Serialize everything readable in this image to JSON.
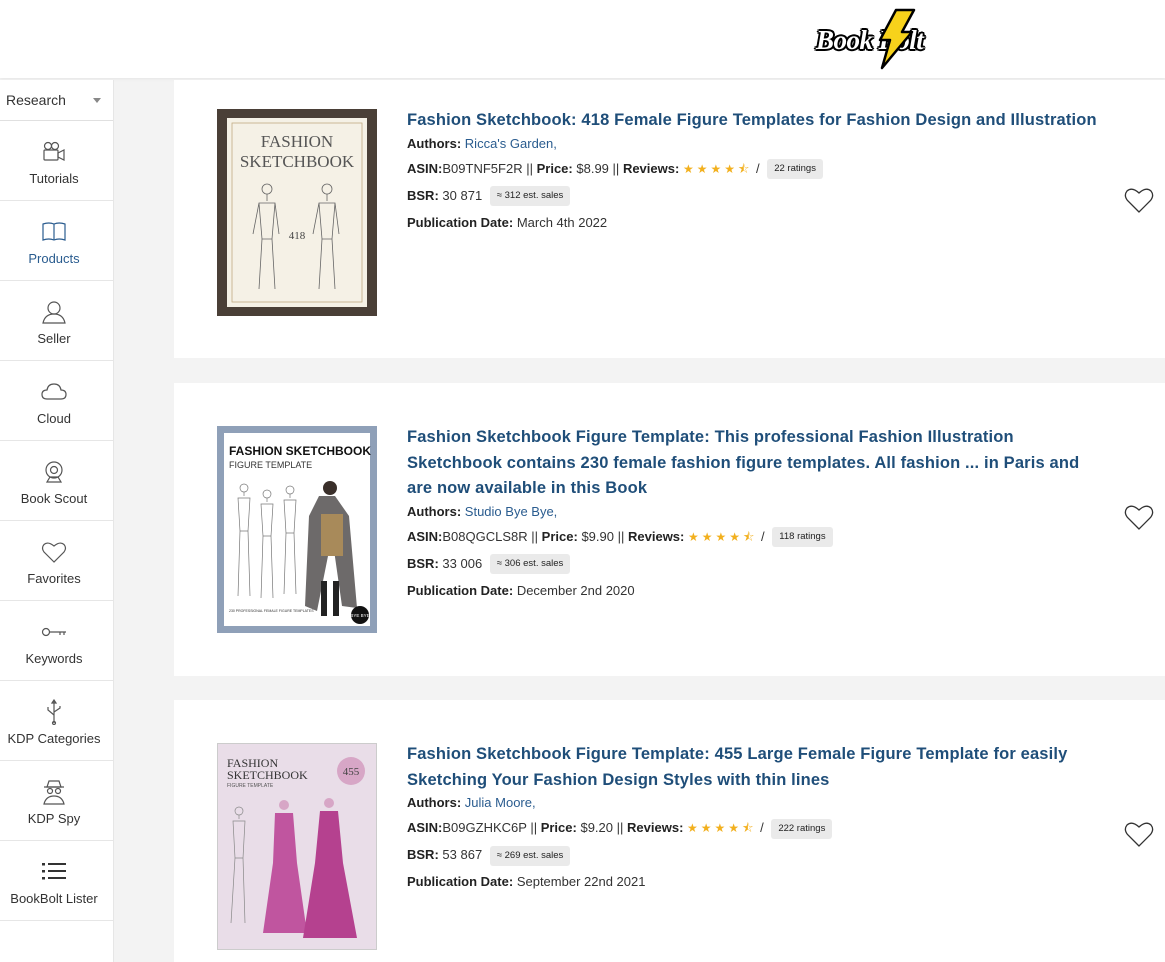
{
  "brand": {
    "logo_text": "Book Bolt"
  },
  "sidebar": {
    "dropdown": {
      "label": "Research"
    },
    "items": [
      {
        "label": "Tutorials",
        "icon": "video-camera-icon"
      },
      {
        "label": "Products",
        "icon": "open-book-icon",
        "active": true
      },
      {
        "label": "Seller",
        "icon": "user-icon"
      },
      {
        "label": "Cloud",
        "icon": "cloud-icon"
      },
      {
        "label": "Book Scout",
        "icon": "webcam-icon"
      },
      {
        "label": "Favorites",
        "icon": "heart-icon"
      },
      {
        "label": "Keywords",
        "icon": "key-icon"
      },
      {
        "label": "KDP Categories",
        "icon": "usb-icon"
      },
      {
        "label": "KDP Spy",
        "icon": "spy-icon"
      },
      {
        "label": "BookBolt Lister",
        "icon": "list-icon"
      }
    ]
  },
  "labels": {
    "authors": "Authors:",
    "asin": "ASIN:",
    "price": "Price:",
    "reviews": "Reviews:",
    "bsr": "BSR:",
    "publication_date": "Publication Date:",
    "sep": "||",
    "slash": "/"
  },
  "products": [
    {
      "title": "Fashion Sketchbook: 418 Female Figure Templates for Fashion Design and Illustration",
      "author": "Ricca's Garden,",
      "asin": "B09TNF5F2R",
      "price": "$8.99",
      "stars": "★★★★⯪",
      "rating": 4.5,
      "ratings_count": "22 ratings",
      "bsr": "30 871",
      "est_sales": "≈ 312 est. sales",
      "publication_date": "March 4th 2022",
      "cover": {
        "line1": "FASHION",
        "line2": "SKETCHBOOK",
        "number": "418",
        "frame_color": "#4a3f37",
        "bg_color": "#f5f1e6"
      }
    },
    {
      "title": "Fashion Sketchbook Figure Template: This professional Fashion Illustration Sketchbook contains 230 female fashion figure templates. All fashion ... in Paris and are now available in this Book",
      "author": "Studio Bye Bye,",
      "asin": "B08QGCLS8R",
      "price": "$9.90",
      "stars": "★★★★⯪",
      "rating": 4.5,
      "ratings_count": "118 ratings",
      "bsr": "33 006",
      "est_sales": "≈ 306 est. sales",
      "publication_date": "December 2nd 2020",
      "cover": {
        "line1": "FASHION SKETCHBOOK",
        "line2": "FIGURE TEMPLATE",
        "badge": "BYE BYE",
        "frame_color": "#8fa0b8",
        "bg_color": "#ffffff"
      }
    },
    {
      "title": "Fashion Sketchbook Figure Template: 455 Large Female Figure Template for easily Sketching Your Fashion Design Styles with thin lines",
      "author": "Julia Moore,",
      "asin": "B09GZHKC6P",
      "price": "$9.20",
      "stars": "★★★★⯪",
      "rating": 4.5,
      "ratings_count": "222 ratings",
      "bsr": "53 867",
      "est_sales": "≈ 269 est. sales",
      "publication_date": "September 22nd 2021",
      "cover": {
        "line1": "FASHION",
        "line2": "SKETCHBOOK",
        "line3": "FIGURE TEMPLATE",
        "number": "455",
        "bg_color": "#e9dde8",
        "accent": "#b5418f"
      }
    }
  ]
}
